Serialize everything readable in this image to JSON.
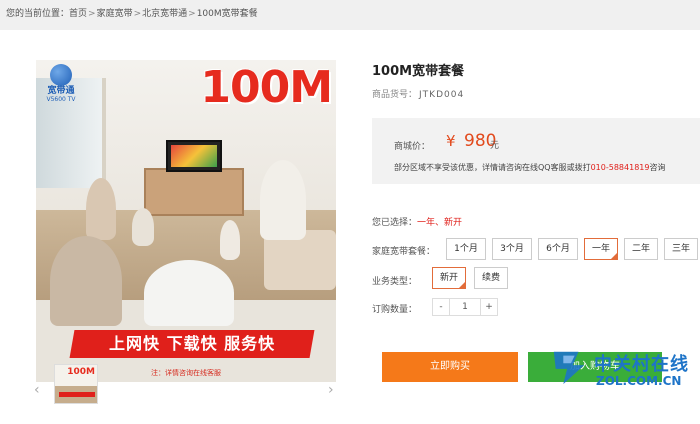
{
  "breadcrumb": {
    "prefix": "您的当前位置：",
    "items": [
      "首页",
      "家庭宽带",
      "北京宽带通",
      "100M宽带套餐"
    ],
    "sep": ">"
  },
  "product": {
    "title": "100M宽带套餐",
    "sku_label": "商品货号：",
    "sku_value": "JTKD004",
    "image": {
      "logo_name": "宽带通",
      "logo_tag": "V5600 TV",
      "speed": "100M",
      "banner": "上网快  下载快  服务快",
      "note": "注：详情咨询在线客服"
    },
    "thumb": {
      "speed": "100M"
    }
  },
  "price": {
    "label": "商城价：",
    "symbol": "¥",
    "value": "980",
    "unit": "元",
    "note_prefix": "部分区域不享受该优惠，详情请咨询在线QQ客服或拨打",
    "phone": "010-58841819",
    "note_suffix": "咨询"
  },
  "selection": {
    "label": "您已选择：",
    "value": "一年、新开"
  },
  "package": {
    "label": "家庭宽带套餐：",
    "options": [
      "1个月",
      "3个月",
      "6个月",
      "一年",
      "二年",
      "三年"
    ],
    "selected_index": 3
  },
  "service": {
    "label": "业务类型：",
    "options": [
      "新开",
      "续费"
    ],
    "selected_index": 0
  },
  "quantity": {
    "label": "订购数量：",
    "minus": "-",
    "value": "1",
    "plus": "+"
  },
  "actions": {
    "buy": "立即购买",
    "cart": "加入购物车"
  },
  "carousel": {
    "prev": "‹",
    "next": "›"
  },
  "watermark": {
    "cn": "中关村在线",
    "en": "ZOL.COM.CN"
  }
}
